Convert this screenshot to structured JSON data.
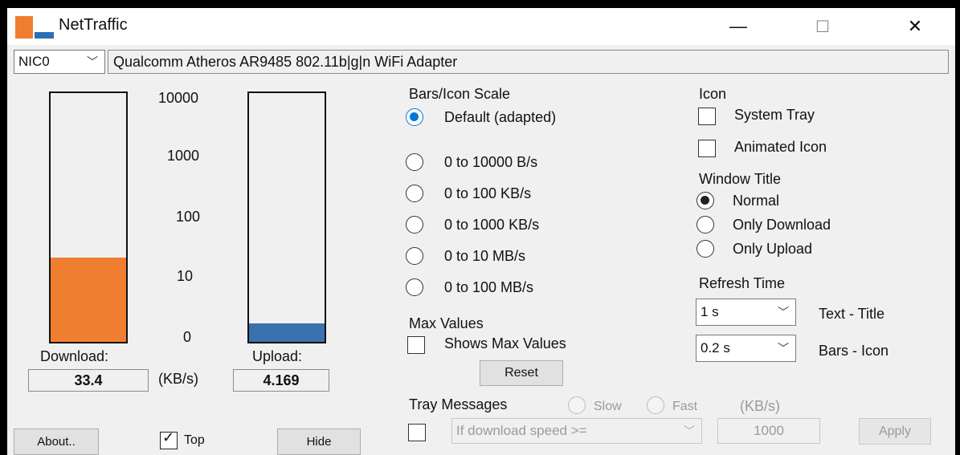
{
  "window": {
    "title": "NetTraffic",
    "minimize_glyph": "—",
    "maximize_glyph": "☐",
    "close_glyph": "✕"
  },
  "colors": {
    "download_bar": "#f07e30",
    "upload_bar": "#3a72ad",
    "accent": "#0078d7"
  },
  "nic": {
    "selected": "NIC0",
    "adapter_name": "Qualcomm Atheros AR9485 802.11b|g|n WiFi Adapter"
  },
  "meters": {
    "scale_labels": [
      "10000",
      "1000",
      "100",
      "10",
      "0"
    ],
    "download_label": "Download:",
    "upload_label": "Upload:",
    "download_value": "33.4",
    "upload_value": "4.169",
    "unit": "(KB/s)",
    "download_level": 0.34,
    "upload_level": 0.075
  },
  "scale": {
    "title": "Bars/Icon Scale",
    "options": [
      "Default (adapted)",
      "0 to 10000 B/s",
      "0 to 100 KB/s",
      "0 to 1000 KB/s",
      "0 to 10 MB/s",
      "0 to 100 MB/s"
    ],
    "selected_index": 0
  },
  "max_values": {
    "title": "Max Values",
    "checkbox_label": "Shows Max Values",
    "reset_label": "Reset"
  },
  "icon": {
    "title": "Icon",
    "system_tray": "System Tray",
    "animated_icon": "Animated Icon"
  },
  "window_title": {
    "title": "Window Title",
    "options": [
      "Normal",
      "Only Download",
      "Only Upload"
    ],
    "selected_index": 0
  },
  "refresh": {
    "title": "Refresh Time",
    "text_value": "1 s",
    "text_label": "Text - Title",
    "bars_value": "0.2 s",
    "bars_label": "Bars - Icon"
  },
  "tray": {
    "title": "Tray Messages",
    "slow": "Slow",
    "fast": "Fast",
    "unit": "(KB/s)",
    "condition": "If download speed >=",
    "threshold": "1000",
    "apply": "Apply"
  },
  "footer": {
    "about": "About..",
    "top": "Top",
    "hide": "Hide"
  }
}
